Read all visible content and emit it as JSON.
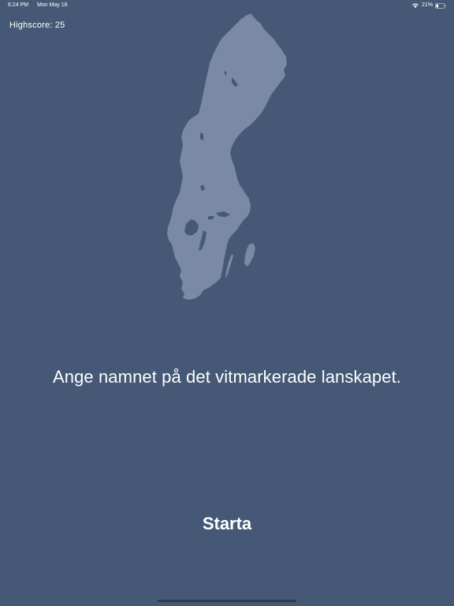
{
  "status_bar": {
    "time": "6:24 PM",
    "date": "Mon May 18",
    "battery": "21%",
    "wifi_icon": "wifi-icon",
    "battery_icon": "battery-icon"
  },
  "highscore": {
    "label": "Highscore: 25"
  },
  "map": {
    "icon": "sweden-map",
    "fill": "#7a8aa5",
    "lake_color": "#455875"
  },
  "prompt": {
    "text": "Ange namnet på det vitmarkerade lanskapet."
  },
  "start_button": {
    "label": "Starta"
  },
  "colors": {
    "background": "#455875",
    "text": "#ffffff"
  }
}
